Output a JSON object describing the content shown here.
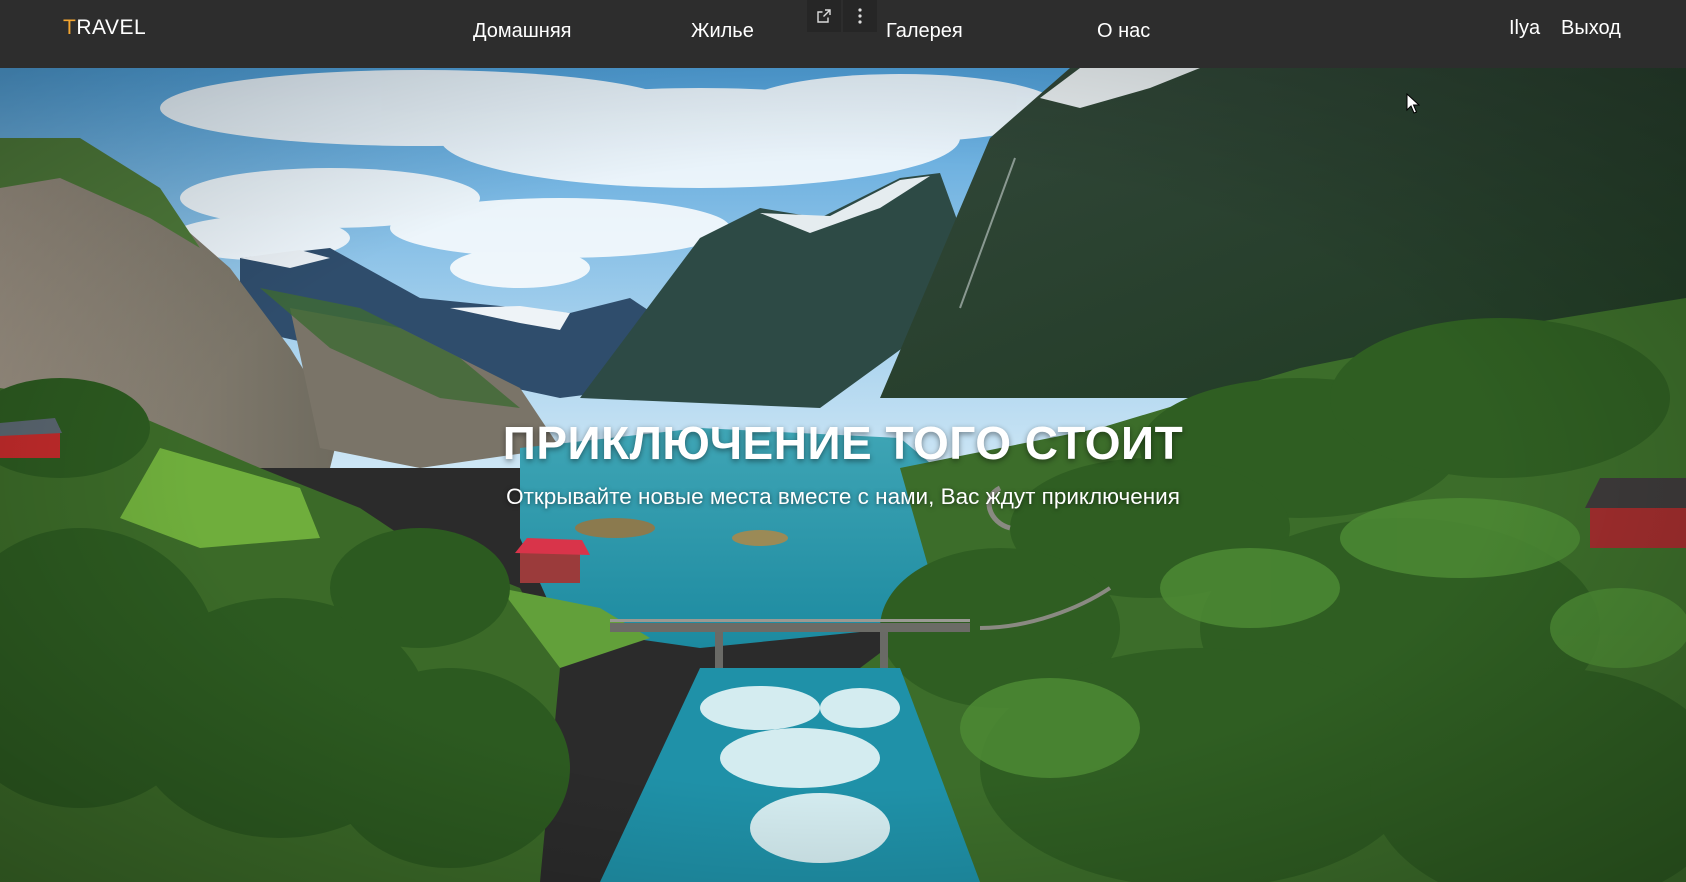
{
  "nav": {
    "logo_first": "T",
    "logo_rest": "RAVEL",
    "links": [
      "Домашняя",
      "Жилье",
      "Галерея",
      "О нас"
    ],
    "user_name": "Ilya",
    "logout_label": "Выход",
    "mini_buttons": [
      "open-in-new-window-icon",
      "more-vertical-icon"
    ]
  },
  "hero": {
    "title": "ПРИКЛЮЧЕНИЕ ТОГО СТОИТ",
    "subtitle": "Открывайте новые места вместе с нами, Вас ждут приключения"
  },
  "colors": {
    "navbar": "#2d2d2d",
    "logo_accent": "#f2a531",
    "text": "#ffffff"
  }
}
